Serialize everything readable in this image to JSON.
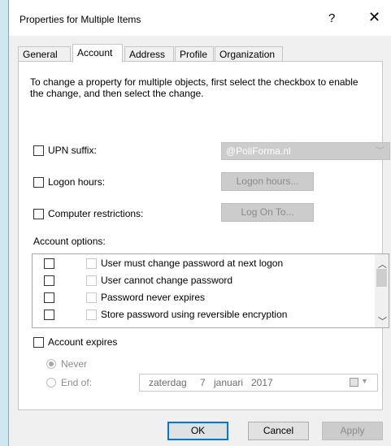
{
  "window": {
    "title": "Properties for Multiple Items",
    "help_glyph": "?",
    "close_glyph": "✕"
  },
  "tabs": [
    {
      "label": "General"
    },
    {
      "label": "Account"
    },
    {
      "label": "Address"
    },
    {
      "label": "Profile"
    },
    {
      "label": "Organization"
    }
  ],
  "active_tab": "Account",
  "description": "To change a property for multiple objects, first select the checkbox to enable the change, and then select the change.",
  "upn": {
    "label": "UPN suffix:",
    "value": "@PoliForma.nl"
  },
  "logon_hours": {
    "label": "Logon hours:",
    "button": "Logon hours..."
  },
  "computer_restrictions": {
    "label": "Computer restrictions:",
    "button": "Log On To..."
  },
  "account_options": {
    "label": "Account options:",
    "items": [
      "User must change password at next logon",
      "User cannot change password",
      "Password never expires",
      "Store password using reversible encryption"
    ]
  },
  "account_expires": {
    "label": "Account expires",
    "never_label": "Never",
    "end_of_label": "End of:",
    "selected": "Never",
    "date": {
      "weekday": "zaterdag",
      "day": "7",
      "month": "januari",
      "year": "2017"
    }
  },
  "buttons": {
    "ok": "OK",
    "cancel": "Cancel",
    "apply": "Apply"
  },
  "colors": {
    "accent": "#0078d7",
    "disabled_text": "#8c8c8c",
    "background": "#f0f0f0"
  }
}
